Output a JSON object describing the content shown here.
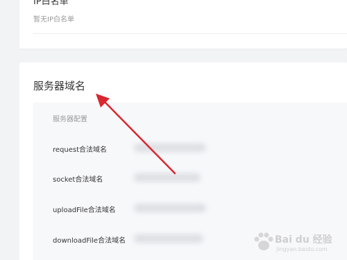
{
  "ip_whitelist": {
    "title": "IP白名单",
    "empty_text": "暂无IP白名单"
  },
  "server_domain": {
    "title": "服务器域名",
    "table_header": "服务器配置",
    "rows": [
      {
        "label": "request合法域名"
      },
      {
        "label": "socket合法域名"
      },
      {
        "label": "uploadFile合法域名"
      },
      {
        "label": "downloadFile合法域名"
      }
    ]
  },
  "watermark": {
    "text": "Bai du 经验",
    "sub": "jingyan.baidu.com"
  },
  "colors": {
    "arrow": "#d9262f",
    "page_bg": "#f2f3f5",
    "card_bg": "#ffffff",
    "table_bg": "#f7f8fa"
  }
}
